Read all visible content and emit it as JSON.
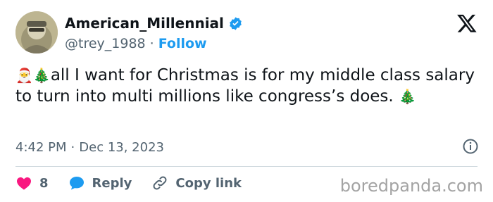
{
  "author": {
    "display_name": "American_Millennial",
    "handle": "@trey_1988",
    "separator": "·",
    "follow_label": "Follow",
    "verified_color": "#1d9bf0"
  },
  "tweet": {
    "emoji_santa": "🎅",
    "emoji_tree": "🎄",
    "text_main": "all I want for Christmas is for my middle class salary to turn into multi millions like congress’s does.",
    "timestamp_time": "4:42 PM",
    "timestamp_sep": "·",
    "timestamp_date": "Dec 13, 2023"
  },
  "actions": {
    "like_count": "8",
    "reply_label": "Reply",
    "copy_link_label": "Copy link"
  },
  "watermark": "boredpanda.com",
  "colors": {
    "accent": "#1d9bf0",
    "like": "#f91880",
    "muted": "#536471"
  }
}
